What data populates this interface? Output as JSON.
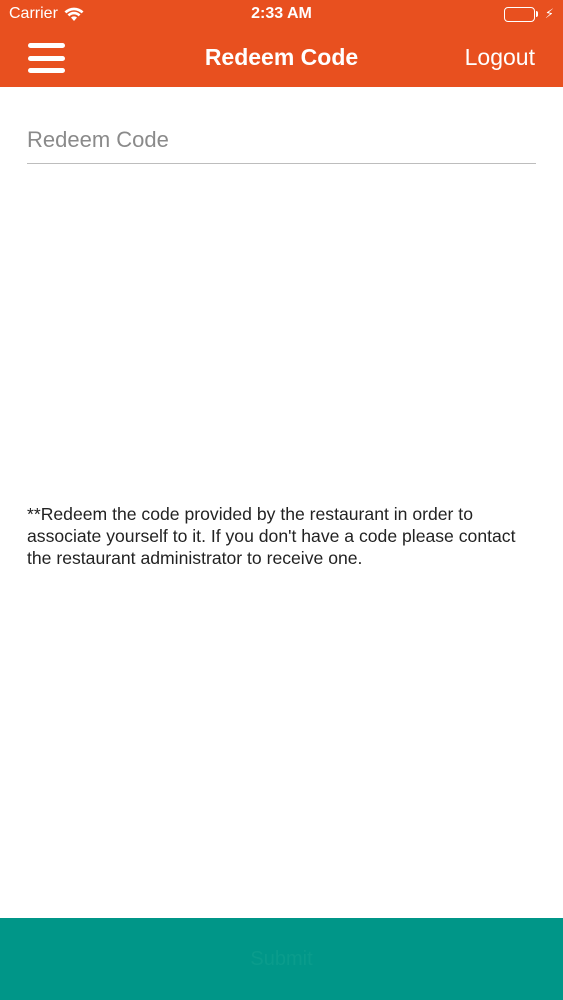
{
  "status_bar": {
    "carrier": "Carrier",
    "time": "2:33 AM",
    "battery_color": "#4CD964"
  },
  "nav": {
    "title": "Redeem Code",
    "logout_label": "Logout",
    "background_color": "#E8501F",
    "menu_icon": "hamburger-menu-icon"
  },
  "form": {
    "code_placeholder": "Redeem Code",
    "code_value": ""
  },
  "info": {
    "text": "**Redeem the code provided by the restaurant in order to associate yourself to it. If you don't have a code please contact the restaurant administrator to receive one."
  },
  "bottom_bar": {
    "label": "Submit",
    "background_color": "#009688"
  }
}
